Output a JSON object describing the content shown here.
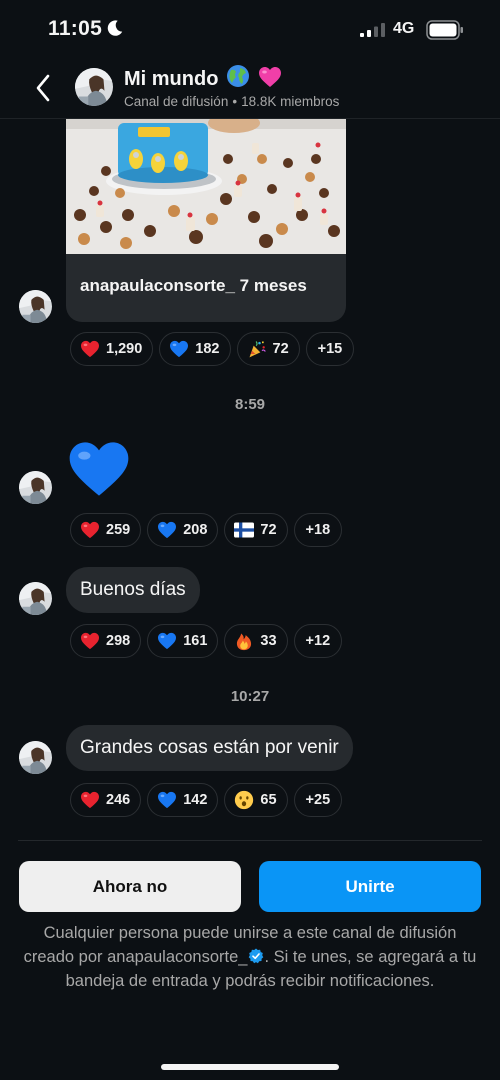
{
  "status_bar": {
    "time": "11:05",
    "network": "4G"
  },
  "header": {
    "title": "Mi mundo",
    "channel_type": "Canal de difusión",
    "separator": "•",
    "members": "18.8K miembros"
  },
  "messages": {
    "shared_post": {
      "caption": "anapaulaconsorte_ 7 meses",
      "reactions": [
        {
          "emoji": "red-heart",
          "count": "1,290"
        },
        {
          "emoji": "blue-heart",
          "count": "182"
        },
        {
          "emoji": "party-popper",
          "count": "72"
        }
      ],
      "more": "+15"
    },
    "time_1": "8:59",
    "big_heart": {
      "emoji": "blue-heart",
      "reactions": [
        {
          "emoji": "red-heart",
          "count": "259"
        },
        {
          "emoji": "blue-heart",
          "count": "208"
        },
        {
          "emoji": "finland-flag",
          "count": "72"
        }
      ],
      "more": "+18"
    },
    "buenos_dias": {
      "text": "Buenos días",
      "reactions": [
        {
          "emoji": "red-heart",
          "count": "298"
        },
        {
          "emoji": "blue-heart",
          "count": "161"
        },
        {
          "emoji": "fire",
          "count": "33"
        }
      ],
      "more": "+12"
    },
    "time_2": "10:27",
    "grandes_cosas": {
      "text": "Grandes cosas están por venir",
      "reactions": [
        {
          "emoji": "red-heart",
          "count": "246"
        },
        {
          "emoji": "blue-heart",
          "count": "142"
        },
        {
          "emoji": "surprised-face",
          "count": "65"
        }
      ],
      "more": "+25"
    }
  },
  "actions": {
    "decline": "Ahora no",
    "join": "Unirte"
  },
  "disclaimer": {
    "before": "Cualquier persona puede unirse a este canal de difusión creado por anapaulaconsorte_",
    "after": ". Si te unes, se agregará a tu bandeja de entrada y podrás recibir notificaciones."
  },
  "colors": {
    "background": "#0c1014",
    "bubble": "#262a2e",
    "accent": "#0a95f6",
    "muted_text": "#a8a8a8"
  }
}
